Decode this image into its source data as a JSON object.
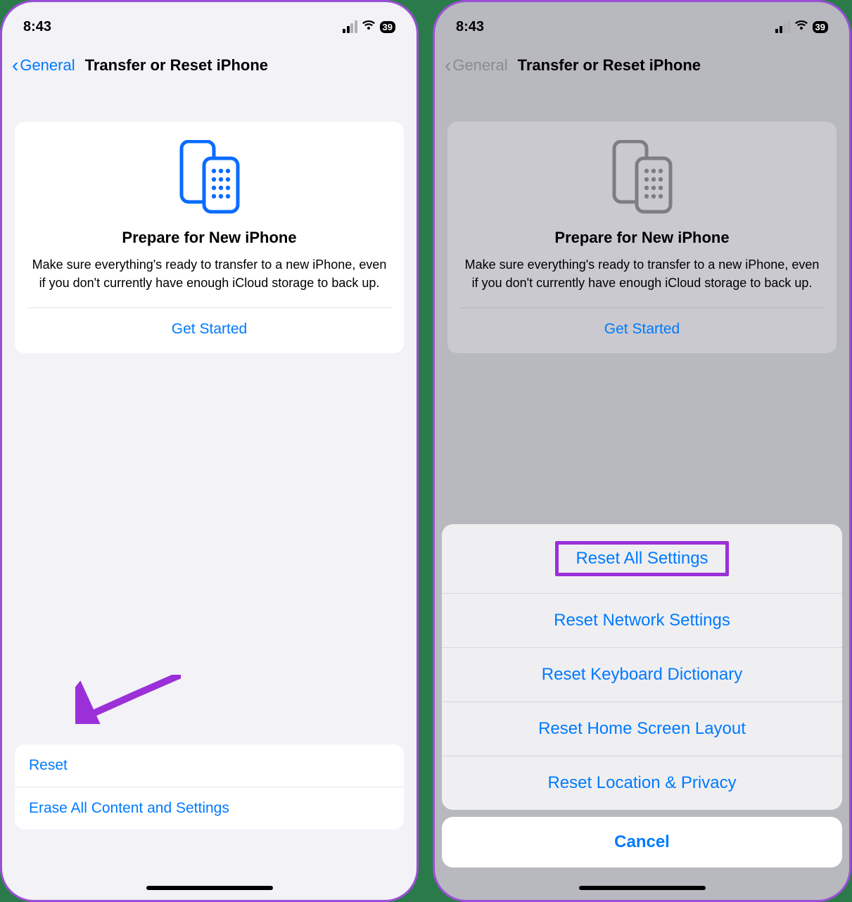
{
  "status": {
    "time": "8:43",
    "battery": "39"
  },
  "nav": {
    "back": "General",
    "title": "Transfer or Reset iPhone"
  },
  "prepare": {
    "title": "Prepare for New iPhone",
    "description": "Make sure everything's ready to transfer to a new iPhone, even if you don't currently have enough iCloud storage to back up.",
    "action": "Get Started"
  },
  "options": {
    "reset": "Reset",
    "erase": "Erase All Content and Settings"
  },
  "sheet": {
    "items": [
      "Reset All Settings",
      "Reset Network Settings",
      "Reset Keyboard Dictionary",
      "Reset Home Screen Layout",
      "Reset Location & Privacy"
    ],
    "cancel": "Cancel"
  }
}
